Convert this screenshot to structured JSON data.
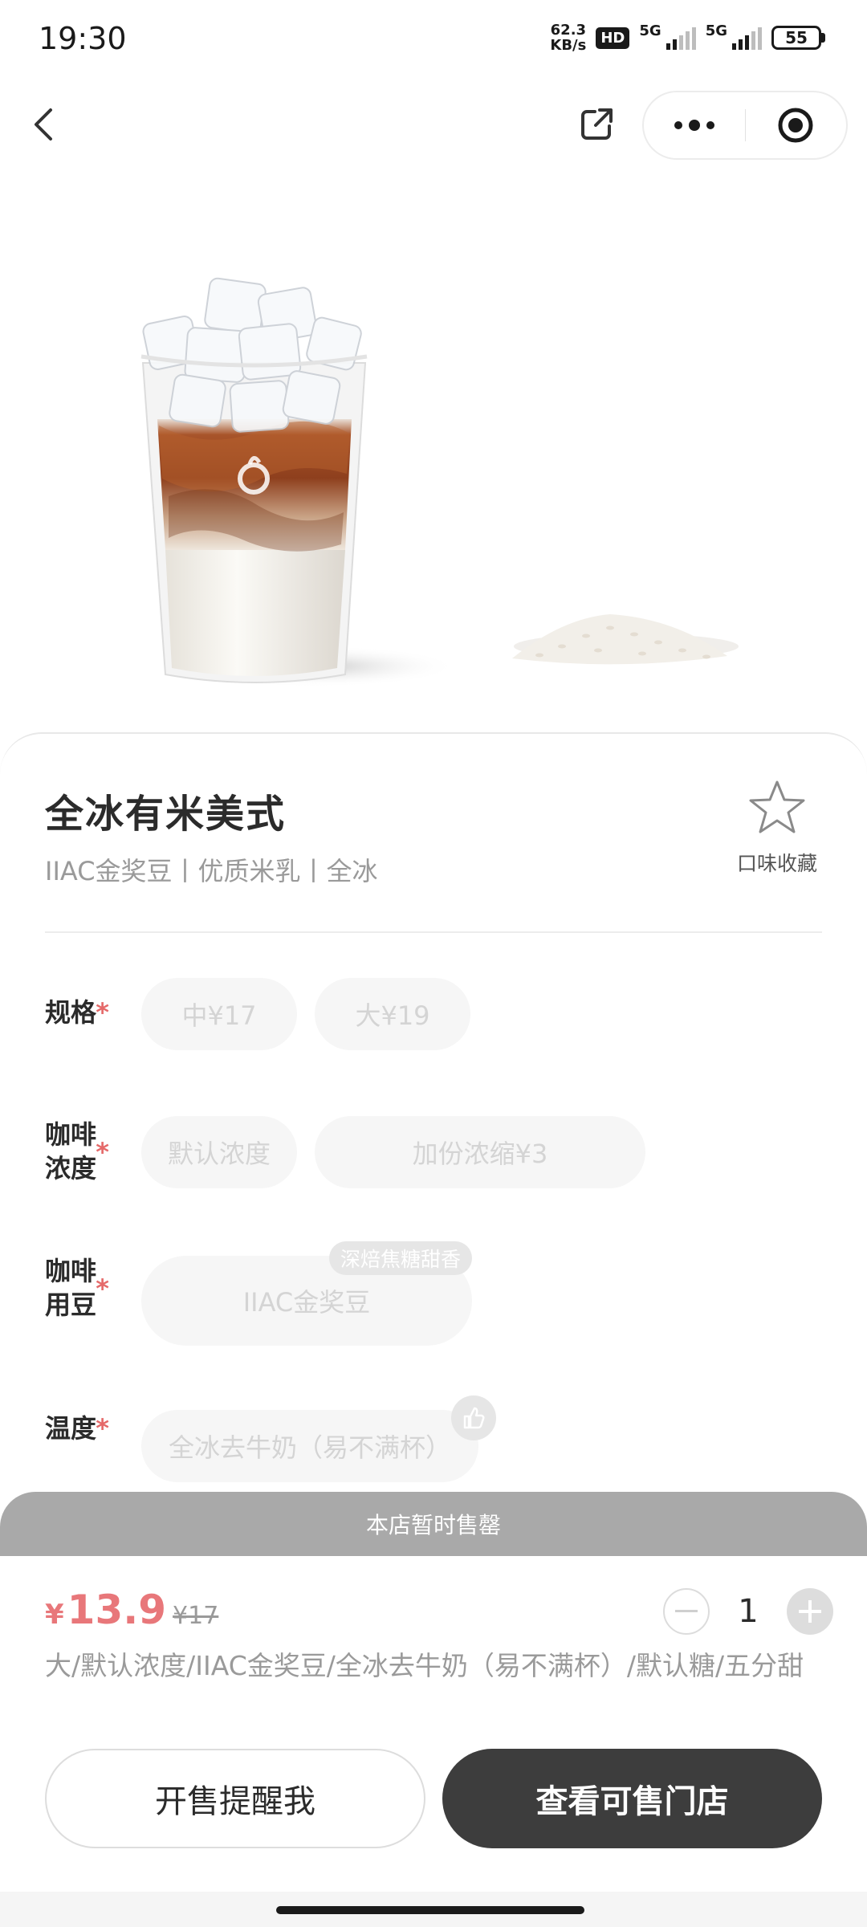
{
  "status_bar": {
    "time": "19:30",
    "net_speed_value": "62.3",
    "net_speed_unit": "KB/s",
    "hd_label": "HD",
    "sim1_label": "5G",
    "sim2_label": "5G",
    "battery_level": "55"
  },
  "product": {
    "name": "全冰有米美式",
    "tags": "IIAC金奖豆丨优质米乳丨全冰",
    "favorite_label": "口味收藏"
  },
  "options": {
    "required_mark": "*",
    "size": {
      "label": "规格",
      "choices": [
        "中¥17",
        "大¥19"
      ]
    },
    "strength": {
      "label_line1": "咖啡",
      "label_line2": "浓度",
      "choices": [
        "默认浓度",
        "加份浓缩¥3"
      ]
    },
    "beans": {
      "label_line1": "咖啡",
      "label_line2": "用豆",
      "choice": "IIAC金奖豆",
      "choice_tag": "深焙焦糖甜香"
    },
    "temperature": {
      "label": "温度",
      "choice": "全冰去牛奶（易不满杯）"
    }
  },
  "sold_out_banner": "本店暂时售罄",
  "checkout": {
    "currency_symbol": "¥",
    "price": "13.9",
    "original_price": "¥17",
    "quantity": "1",
    "selection_summary": "大/默认浓度/IIAC金奖豆/全冰去牛奶（易不满杯）/默认糖/五分甜",
    "remind_button": "开售提醒我",
    "stores_button": "查看可售门店"
  },
  "icons": {
    "back": "back-arrow-icon",
    "share": "share-icon",
    "more": "more-dots-icon",
    "close": "target-icon",
    "favorite": "star-icon",
    "thumbs_up": "thumbs-up-icon",
    "minus": "minus-icon",
    "plus": "plus-icon"
  },
  "colors": {
    "price_accent": "#e8777a",
    "primary_button": "#3d3d3d",
    "sold_out_bar": "#a9a9a9",
    "disabled_chip": "#f6f6f6"
  }
}
